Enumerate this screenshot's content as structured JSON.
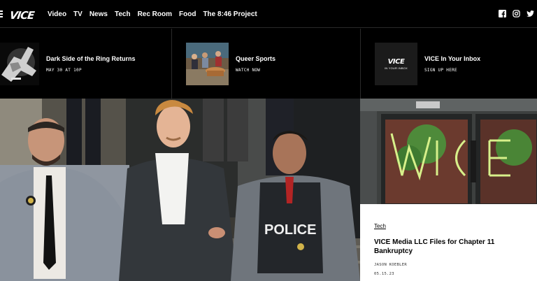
{
  "brand": {
    "logo": "VICE"
  },
  "nav": {
    "links": [
      "Video",
      "TV",
      "News",
      "Tech",
      "Rec Room",
      "Food",
      "The 8:46 Project"
    ]
  },
  "social": [
    "facebook-icon",
    "instagram-icon",
    "twitter-icon"
  ],
  "promos": [
    {
      "title": "Dark Side of the Ring Returns",
      "subtitle": "MAY 30 AT 10P"
    },
    {
      "title": "Queer Sports",
      "subtitle": "WATCH NOW"
    },
    {
      "title": "VICE In Your Inbox",
      "subtitle": "SIGN UP HERE",
      "thumb_logo": "VICE",
      "thumb_sub": "IN YOUR INBOX"
    }
  ],
  "hero": {
    "vest_text": "POLICE"
  },
  "feature": {
    "category": "Tech",
    "headline": "VICE Media LLC Files for Chapter 11 Bankruptcy",
    "author": "JASON KOEBLER",
    "date": "05.15.23"
  }
}
